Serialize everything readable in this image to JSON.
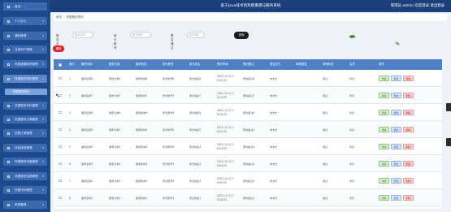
{
  "header": {
    "title": "基于Java技术的热壁重建与服务系统",
    "user_text": "管理员 admin  欢迎登录  退出登录"
  },
  "sidebar": {
    "items": [
      {
        "label": "首页"
      },
      {
        "label": "个人中心"
      },
      {
        "label": "通知管理"
      },
      {
        "label": "注册用户管理"
      },
      {
        "label": "热壁建模服务管理"
      },
      {
        "label": "热壁服务预约管理"
      },
      {
        "label": "热壁服务评价管理"
      },
      {
        "label": "热壁服务订单管理"
      },
      {
        "label": "热壁订单管理"
      },
      {
        "label": "项目信息管理"
      },
      {
        "label": "热壁服务进度管理"
      },
      {
        "label": "热壁服务结算管理"
      },
      {
        "label": "热壁评价管理"
      },
      {
        "label": "系统管理"
      }
    ],
    "active_sub": "热壁服务预约"
  },
  "breadcrumb": {
    "home": "首页",
    "current": "热壁服务预约"
  },
  "search": {
    "label1": "服务名称",
    "placeholder1": "服务名称",
    "label2": "家长账号",
    "placeholder2": "家长账号",
    "label3": "是否通过",
    "placeholder3": "是否通过",
    "button": "查询"
  },
  "actions": {
    "delete": "删除"
  },
  "table": {
    "headers": [
      "索引",
      "服务名称",
      "服务分类",
      "服务机构",
      "家长账号",
      "家长姓名",
      "预约时间",
      "预约备注",
      "是否支付",
      "审核回复",
      "审核状态",
      "会员",
      "操作"
    ],
    "rows": [
      {
        "idx": "1",
        "name": "服务名称8",
        "cat": "服务分类8",
        "org": "服务机构8",
        "acct": "家长账号8",
        "pname": "家长姓名8",
        "date": "2022-12-12 1",
        "time": "6:53:25",
        "note": "预约备注8",
        "paid": "未支付",
        "reply": "",
        "status": "通过",
        "member": "审核"
      },
      {
        "idx": "2",
        "name": "服务名称7",
        "cat": "服务分类7",
        "org": "服务机构7",
        "acct": "家长账号7",
        "pname": "家长姓名7",
        "date": "2022-12-12 1",
        "time": "6:53:25",
        "note": "预约备注7",
        "paid": "未支付",
        "reply": "",
        "status": "通过",
        "member": "审核"
      },
      {
        "idx": "3",
        "name": "服务名称6",
        "cat": "服务分类6",
        "org": "服务机构6",
        "acct": "家长账号6",
        "pname": "家长姓名6",
        "date": "2022-12-12 1",
        "time": "6:53:25",
        "note": "预约备注6",
        "paid": "未支付",
        "reply": "",
        "status": "通过",
        "member": "审核"
      },
      {
        "idx": "4",
        "name": "服务名称5",
        "cat": "服务分类5",
        "org": "服务机构5",
        "acct": "家长账号5",
        "pname": "家长姓名5",
        "date": "2022-12-12 1",
        "time": "6:53:25",
        "note": "预约备注5",
        "paid": "未支付",
        "reply": "",
        "status": "通过",
        "member": "审核"
      },
      {
        "idx": "5",
        "name": "服务名称4",
        "cat": "服务分类4",
        "org": "服务机构4",
        "acct": "家长账号4",
        "pname": "家长姓名4",
        "date": "2022-12-12 1",
        "time": "6:53:25",
        "note": "预约备注4",
        "paid": "未支付",
        "reply": "",
        "status": "通过",
        "member": "审核"
      },
      {
        "idx": "6",
        "name": "服务名称3",
        "cat": "服务分类3",
        "org": "服务机构3",
        "acct": "家长账号3",
        "pname": "家长姓名3",
        "date": "2022-12-12 1",
        "time": "6:53:25",
        "note": "预约备注3",
        "paid": "未支付",
        "reply": "",
        "status": "通过",
        "member": "审核"
      },
      {
        "idx": "7",
        "name": "服务名称2",
        "cat": "服务分类2",
        "org": "服务机构2",
        "acct": "家长账号2",
        "pname": "家长姓名2",
        "date": "2022-12-12 1",
        "time": "6:53:25",
        "note": "预约备注2",
        "paid": "未支付",
        "reply": "",
        "status": "通过",
        "member": "审核"
      },
      {
        "idx": "8",
        "name": "服务名称1",
        "cat": "服务分类1",
        "org": "服务机构1",
        "acct": "家长账号1",
        "pname": "家长姓名1",
        "date": "2022-12-12 1",
        "time": "6:53:25",
        "note": "预约备注1",
        "paid": "未支付",
        "reply": "",
        "status": "通过",
        "member": "审核"
      }
    ],
    "ops": {
      "detail": "详情",
      "edit": "修改",
      "del": "删除"
    }
  },
  "colors": {
    "topbar": "#1a3f7a",
    "sidebar": "#1d4a8c",
    "table_header": "#4f7fc5",
    "delete_btn": "#e0222a"
  }
}
